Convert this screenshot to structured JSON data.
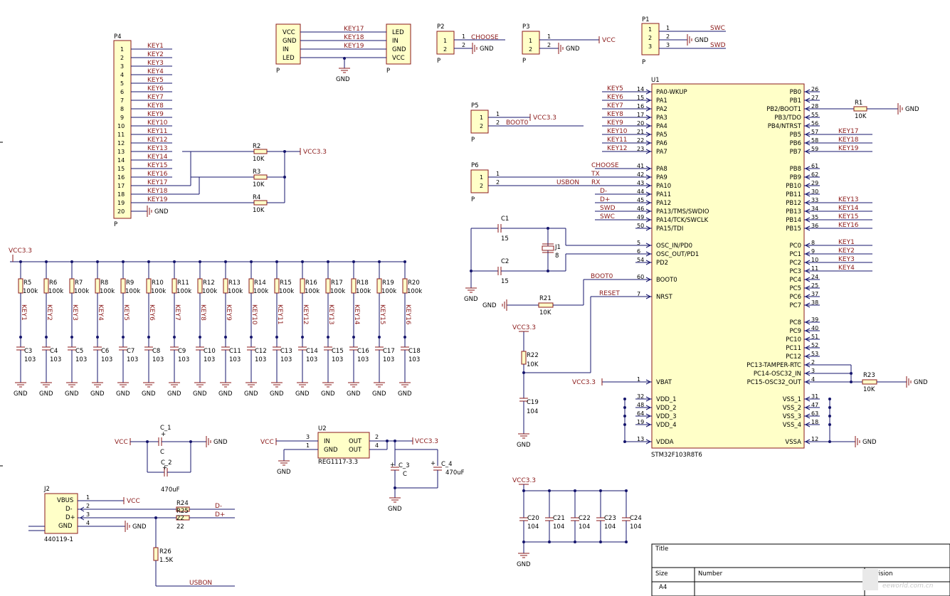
{
  "p4": {
    "ref": "P4",
    "type": "P",
    "pins": [
      "1",
      "2",
      "3",
      "4",
      "5",
      "6",
      "7",
      "8",
      "9",
      "10",
      "11",
      "12",
      "13",
      "14",
      "15",
      "16",
      "17",
      "18",
      "19",
      "20"
    ],
    "nets": [
      "KEY1",
      "KEY2",
      "KEY3",
      "KEY4",
      "KEY5",
      "KEY6",
      "KEY7",
      "KEY8",
      "KEY9",
      "KEY10",
      "KEY11",
      "KEY12",
      "KEY13",
      "KEY14",
      "KEY15",
      "KEY16",
      "KEY17",
      "KEY18",
      "KEY19",
      "GND"
    ]
  },
  "pullup_top": [
    {
      "ref": "R2",
      "val": "10K"
    },
    {
      "ref": "R3",
      "val": "10K"
    },
    {
      "ref": "R4",
      "val": "10K"
    }
  ],
  "vcc33": "VCC3.3",
  "gnd": "GND",
  "vcc": "VCC",
  "ledmod": {
    "left": [
      "VCC",
      "GND",
      "IN",
      "LED"
    ],
    "right": [
      "LED",
      "IN",
      "GND",
      "VCC"
    ],
    "nets": [
      "KEY17",
      "KEY18",
      "KEY19"
    ],
    "type_l": "P",
    "type_r": "P"
  },
  "p2": {
    "ref": "P2",
    "pins": [
      "1",
      "2"
    ],
    "nets": [
      "CHOOSE",
      "GND"
    ],
    "type": "P"
  },
  "p3": {
    "ref": "P3",
    "pins": [
      "1",
      "2"
    ],
    "nets": [
      "VCC",
      "GND"
    ],
    "type": "P"
  },
  "p1": {
    "ref": "P1",
    "pins": [
      "1",
      "2",
      "3"
    ],
    "nets": [
      "SWC",
      "GND",
      "SWD"
    ],
    "type": "P"
  },
  "p5": {
    "ref": "P5",
    "pins": [
      "1",
      "2"
    ],
    "nets": [
      "VCC3.3",
      "BOOT0"
    ],
    "type": "P"
  },
  "p6": {
    "ref": "P6",
    "pins": [
      "1",
      "2"
    ],
    "nets": [
      "TX",
      "RX",
      "USBON"
    ],
    "type": "P"
  },
  "caps": {
    "c1": {
      "ref": "C1",
      "val": "15"
    },
    "c2": {
      "ref": "C2",
      "val": "15"
    },
    "j1": {
      "ref": "J1",
      "val": "8"
    }
  },
  "r21": {
    "ref": "R21",
    "val": "10K"
  },
  "r22": {
    "ref": "R22",
    "val": "10K"
  },
  "c19": {
    "ref": "C19",
    "val": "104"
  },
  "nets_mid": {
    "boot0": "BOOT0",
    "reset": "RESET",
    "choose": "CHOOSE",
    "tx": "TX",
    "rx": "RX",
    "dm": "D-",
    "dp": "D+",
    "swd": "SWD",
    "swc": "SWC"
  },
  "u1": {
    "ref": "U1",
    "part": "STM32F103R8T6",
    "left": [
      {
        "pin": "PA0-WKUP",
        "num": "14",
        "net": "KEY5"
      },
      {
        "pin": "PA1",
        "num": "15",
        "net": "KEY6"
      },
      {
        "pin": "PA2",
        "num": "16",
        "net": "KEY7"
      },
      {
        "pin": "PA3",
        "num": "17",
        "net": "KEY8"
      },
      {
        "pin": "PA4",
        "num": "20",
        "net": "KEY9"
      },
      {
        "pin": "PA5",
        "num": "21",
        "net": "KEY10"
      },
      {
        "pin": "PA6",
        "num": "22",
        "net": "KEY11"
      },
      {
        "pin": "PA7",
        "num": "23",
        "net": "KEY12"
      },
      {
        "pin": "PA8",
        "num": "41",
        "net": "CHOOSE"
      },
      {
        "pin": "PA9",
        "num": "42",
        "net": "TX"
      },
      {
        "pin": "PA10",
        "num": "43",
        "net": "RX"
      },
      {
        "pin": "PA11",
        "num": "44",
        "net": "D-"
      },
      {
        "pin": "PA12",
        "num": "45",
        "net": "D+"
      },
      {
        "pin": "PA13/TMS/SWDIO",
        "num": "46",
        "net": "SWD"
      },
      {
        "pin": "PA14/TCK/SWCLK",
        "num": "49",
        "net": "SWC"
      },
      {
        "pin": "PA15/TDI",
        "num": "50",
        "net": ""
      },
      {
        "pin": "OSC_IN/PD0",
        "num": "5",
        "net": ""
      },
      {
        "pin": "OSC_OUT/PD1",
        "num": "6",
        "net": ""
      },
      {
        "pin": "PD2",
        "num": "54",
        "net": ""
      },
      {
        "pin": "BOOT0",
        "num": "60",
        "net": "BOOT0"
      },
      {
        "pin": "NRST",
        "num": "7",
        "net": "RESET"
      },
      {
        "pin": "VBAT",
        "num": "1",
        "net": "VCC3.3"
      },
      {
        "pin": "VDD_1",
        "num": "32",
        "net": ""
      },
      {
        "pin": "VDD_2",
        "num": "48",
        "net": ""
      },
      {
        "pin": "VDD_3",
        "num": "64",
        "net": ""
      },
      {
        "pin": "VDD_4",
        "num": "19",
        "net": ""
      },
      {
        "pin": "VDDA",
        "num": "13",
        "net": ""
      }
    ],
    "right": [
      {
        "pin": "PB0",
        "num": "26",
        "net": ""
      },
      {
        "pin": "PB1",
        "num": "27",
        "net": ""
      },
      {
        "pin": "PB2/BOOT1",
        "num": "28",
        "net": ""
      },
      {
        "pin": "PB3/TDO",
        "num": "55",
        "net": ""
      },
      {
        "pin": "PB4/NTRST",
        "num": "56",
        "net": ""
      },
      {
        "pin": "PB5",
        "num": "57",
        "net": "KEY17"
      },
      {
        "pin": "PB6",
        "num": "58",
        "net": "KEY18"
      },
      {
        "pin": "PB7",
        "num": "59",
        "net": "KEY19"
      },
      {
        "pin": "PB8",
        "num": "61",
        "net": ""
      },
      {
        "pin": "PB9",
        "num": "62",
        "net": ""
      },
      {
        "pin": "PB10",
        "num": "29",
        "net": ""
      },
      {
        "pin": "PB11",
        "num": "30",
        "net": ""
      },
      {
        "pin": "PB12",
        "num": "33",
        "net": "KEY13"
      },
      {
        "pin": "PB13",
        "num": "34",
        "net": "KEY14"
      },
      {
        "pin": "PB14",
        "num": "35",
        "net": "KEY15"
      },
      {
        "pin": "PB15",
        "num": "36",
        "net": "KEY16"
      },
      {
        "pin": "PC0",
        "num": "8",
        "net": "KEY1"
      },
      {
        "pin": "PC1",
        "num": "9",
        "net": "KEY2"
      },
      {
        "pin": "PC2",
        "num": "10",
        "net": "KEY3"
      },
      {
        "pin": "PC3",
        "num": "11",
        "net": "KEY4"
      },
      {
        "pin": "PC4",
        "num": "24",
        "net": ""
      },
      {
        "pin": "PC5",
        "num": "25",
        "net": ""
      },
      {
        "pin": "PC6",
        "num": "37",
        "net": ""
      },
      {
        "pin": "PC7",
        "num": "38",
        "net": ""
      },
      {
        "pin": "PC8",
        "num": "39",
        "net": ""
      },
      {
        "pin": "PC9",
        "num": "40",
        "net": ""
      },
      {
        "pin": "PC10",
        "num": "51",
        "net": ""
      },
      {
        "pin": "PC11",
        "num": "52",
        "net": ""
      },
      {
        "pin": "PC12",
        "num": "53",
        "net": ""
      },
      {
        "pin": "PC13-TAMPER-RTC",
        "num": "2",
        "net": ""
      },
      {
        "pin": "PC14-OSC32_IN",
        "num": "3",
        "net": ""
      },
      {
        "pin": "PC15-OSC32_OUT",
        "num": "4",
        "net": ""
      },
      {
        "pin": "VSS_1",
        "num": "31",
        "net": ""
      },
      {
        "pin": "VSS_2",
        "num": "47",
        "net": ""
      },
      {
        "pin": "VSS_3",
        "num": "63",
        "net": ""
      },
      {
        "pin": "VSS_4",
        "num": "18",
        "net": ""
      },
      {
        "pin": "VSSA",
        "num": "12",
        "net": ""
      }
    ]
  },
  "r1": {
    "ref": "R1",
    "val": "10K"
  },
  "r23": {
    "ref": "R23",
    "val": "10K"
  },
  "pullups": [
    {
      "r": "R5",
      "c": "C3",
      "key": "KEY1"
    },
    {
      "r": "R6",
      "c": "C4",
      "key": "KEY2"
    },
    {
      "r": "R7",
      "c": "C5",
      "key": "KEY3"
    },
    {
      "r": "R8",
      "c": "C6",
      "key": "KEY4"
    },
    {
      "r": "R9",
      "c": "C7",
      "key": "KEY5"
    },
    {
      "r": "R10",
      "c": "C8",
      "key": "KEY6"
    },
    {
      "r": "R11",
      "c": "C9",
      "key": "KEY7"
    },
    {
      "r": "R12",
      "c": "C10",
      "key": "KEY8"
    },
    {
      "r": "R13",
      "c": "C11",
      "key": "KEY9"
    },
    {
      "r": "R14",
      "c": "C12",
      "key": "KEY10"
    },
    {
      "r": "R15",
      "c": "C13",
      "key": "KEY11"
    },
    {
      "r": "R16",
      "c": "C14",
      "key": "KEY12"
    },
    {
      "r": "R17",
      "c": "C15",
      "key": "KEY13"
    },
    {
      "r": "R18",
      "c": "C16",
      "key": "KEY14"
    },
    {
      "r": "R19",
      "c": "C17",
      "key": "KEY15"
    },
    {
      "r": "R20",
      "c": "C18",
      "key": "KEY16"
    }
  ],
  "pullup_val": "100k",
  "cap_val": "103",
  "power": {
    "c_1": "C_1",
    "c_1v": "C",
    "c_2": "C_2",
    "c_2v": "470uF",
    "u2": "U2",
    "u2part": "REG1117-3.3",
    "u2left": [
      "IN",
      "GND"
    ],
    "u2right": [
      "OUT",
      "OUT"
    ],
    "u2lnum": [
      "3",
      "1"
    ],
    "u2rnum": [
      "2",
      "4"
    ],
    "c_3": "C_3",
    "c_3v": "C",
    "c_4": "C_4",
    "c_4v": "470uF"
  },
  "usb": {
    "ref": "J2",
    "part": "440119-1",
    "pins": [
      "VBUS",
      "D-",
      "D+",
      "GND"
    ],
    "nums": [
      "1",
      "2",
      "3",
      "4"
    ],
    "r24": "R24",
    "r25": "R25",
    "rv": "22",
    "r26": "R26",
    "r26v": "1.5K",
    "usbon": "USBON"
  },
  "decap": [
    {
      "ref": "C20",
      "val": "104"
    },
    {
      "ref": "C21",
      "val": "104"
    },
    {
      "ref": "C22",
      "val": "104"
    },
    {
      "ref": "C23",
      "val": "104"
    },
    {
      "ref": "C24",
      "val": "104"
    }
  ],
  "title_block": {
    "title": "Title",
    "size": "Size",
    "number": "Number",
    "revision": "Revision",
    "size_val": "A4"
  },
  "watermark": "eeworld.com.cn"
}
